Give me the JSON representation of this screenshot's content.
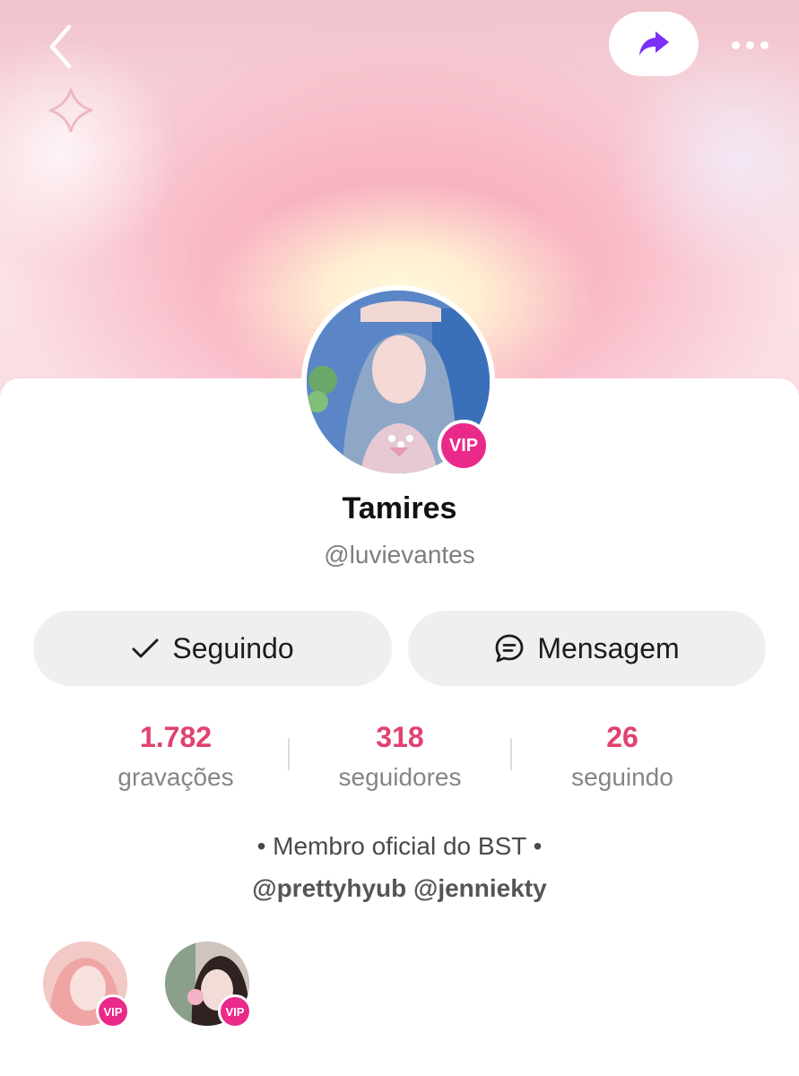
{
  "header": {
    "back_icon": "chevron-left-icon",
    "share_icon": "share-arrow-icon",
    "more_icon": "more-horizontal-icon"
  },
  "profile": {
    "name": "Tamires",
    "handle": "@luvievantes",
    "badge": "VIP"
  },
  "actions": {
    "follow_label": "Seguindo",
    "message_label": "Mensagem"
  },
  "stats": [
    {
      "value": "1.782",
      "label": "gravações"
    },
    {
      "value": "318",
      "label": "seguidores"
    },
    {
      "value": "26",
      "label": "seguindo"
    }
  ],
  "bio": {
    "line1": "• Membro oficial do BST •",
    "line2": "@prettyhyub @jenniekty"
  },
  "linked_profiles": [
    {
      "badge": "VIP"
    },
    {
      "badge": "VIP"
    }
  ],
  "colors": {
    "accent_pink": "#e0426f",
    "vip_pink": "#ea2a8a",
    "share_purple": "#7b2ff7",
    "button_gray": "#efefef"
  }
}
